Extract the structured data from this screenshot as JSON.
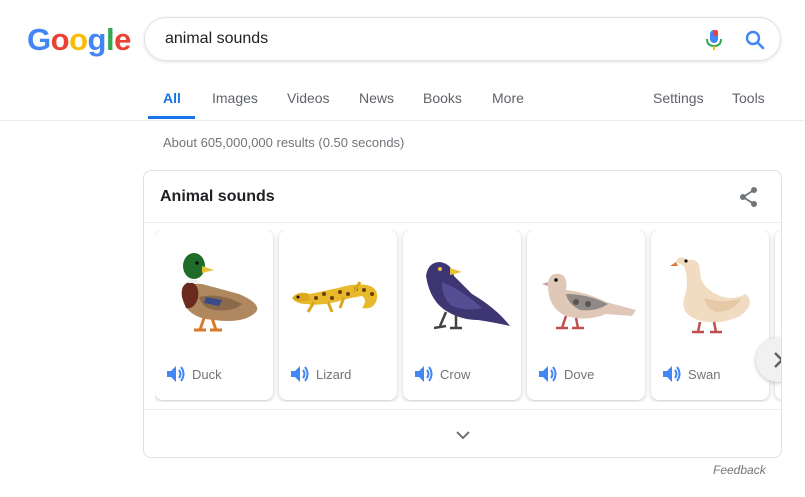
{
  "logo": {
    "letters": [
      "G",
      "o",
      "o",
      "g",
      "l",
      "e"
    ]
  },
  "search": {
    "query": "animal sounds"
  },
  "tabs": [
    {
      "label": "All"
    },
    {
      "label": "Images"
    },
    {
      "label": "Videos"
    },
    {
      "label": "News"
    },
    {
      "label": "Books"
    },
    {
      "label": "More"
    },
    {
      "label": "Settings"
    },
    {
      "label": "Tools"
    }
  ],
  "stats": "About 605,000,000 results (0.50 seconds)",
  "card": {
    "title": "Animal sounds",
    "animals": [
      {
        "name": "Duck"
      },
      {
        "name": "Lizard"
      },
      {
        "name": "Crow"
      },
      {
        "name": "Dove"
      },
      {
        "name": "Swan"
      }
    ]
  },
  "feedback": "Feedback",
  "colors": {
    "blue": "#4285F4",
    "red": "#EA4335",
    "yellow": "#FBBC05",
    "green": "#34A853",
    "active_tab": "#1a73e8"
  }
}
